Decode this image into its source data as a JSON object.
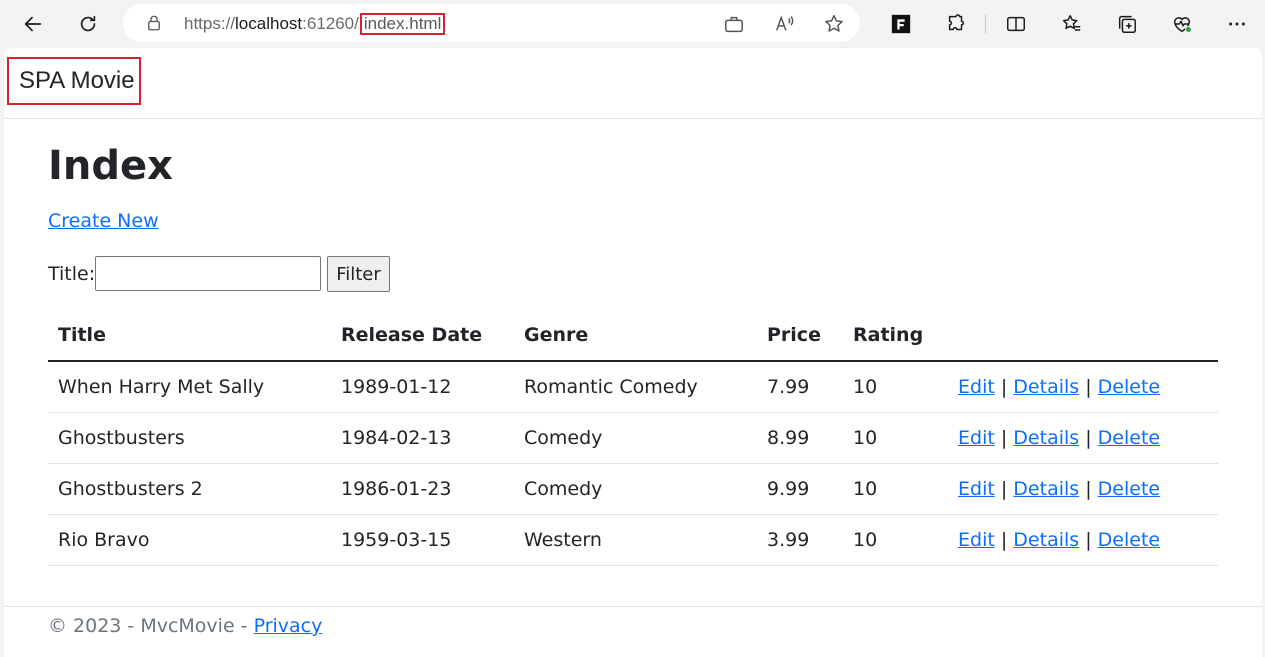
{
  "browser": {
    "url_prefix": "https://",
    "url_host": "localhost",
    "url_port": ":61260/",
    "url_path": "index.html"
  },
  "navbar": {
    "brand": "SPA Movie"
  },
  "page": {
    "heading": "Index",
    "create_link": "Create New",
    "filter": {
      "label": "Title:",
      "value": "",
      "button": "Filter"
    }
  },
  "table": {
    "headers": [
      "Title",
      "Release Date",
      "Genre",
      "Price",
      "Rating",
      ""
    ],
    "rows": [
      {
        "title": "When Harry Met Sally",
        "release_date": "1989-01-12",
        "genre": "Romantic Comedy",
        "price": "7.99",
        "rating": "10"
      },
      {
        "title": "Ghostbusters",
        "release_date": "1984-02-13",
        "genre": "Comedy",
        "price": "8.99",
        "rating": "10"
      },
      {
        "title": "Ghostbusters 2",
        "release_date": "1986-01-23",
        "genre": "Comedy",
        "price": "9.99",
        "rating": "10"
      },
      {
        "title": "Rio Bravo",
        "release_date": "1959-03-15",
        "genre": "Western",
        "price": "3.99",
        "rating": "10"
      }
    ],
    "actions": {
      "edit": "Edit",
      "details": "Details",
      "delete": "Delete",
      "separator": "|"
    }
  },
  "footer": {
    "copyright": "© 2023 - MvcMovie - ",
    "privacy": "Privacy"
  },
  "colors": {
    "link": "#0d6efd",
    "highlight_box": "#d0242e",
    "text": "#212529"
  }
}
